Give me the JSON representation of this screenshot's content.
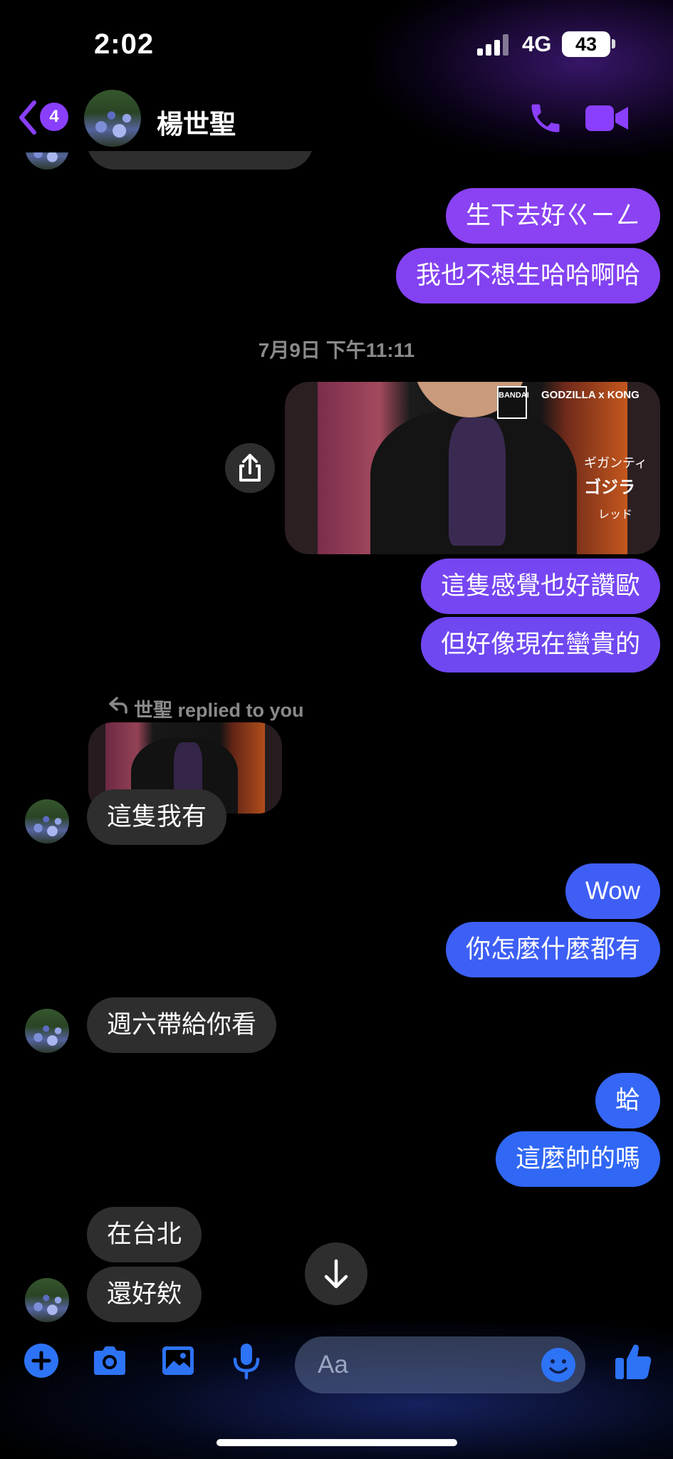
{
  "status_bar": {
    "time": "2:02",
    "network": "4G",
    "battery": "43"
  },
  "header": {
    "back_badge_count": "4",
    "contact_name": "楊世聖",
    "colors": {
      "accent": "#8a3ffc"
    }
  },
  "timestamp": "7月9日 下午11:11",
  "reply_label": "世聖 replied to you",
  "messages": {
    "out_1": "生下去好ㄍㄧㄥ",
    "out_2": "我也不想生哈哈啊哈",
    "out_3": "這隻感覺也好讚歐",
    "out_4": "但好像現在蠻貴的",
    "in_1": "這隻我有",
    "out_5": "Wow",
    "out_6": "你怎麼什麼都有",
    "in_2": "週六帶給你看",
    "out_7": "蛤",
    "out_8": "這麼帥的嗎",
    "in_3": "在台北",
    "in_4": "還好欸"
  },
  "photo_text": {
    "brand": "BANDAI",
    "title": "GODZILLA x KONG",
    "jp_1": "ギガンティ",
    "jp_2": "ゴジラ",
    "jp_3": "レッド"
  },
  "composer": {
    "placeholder": "Aa"
  },
  "icons": {
    "back": "chevron-left-icon",
    "call": "phone-icon",
    "video": "video-camera-icon",
    "share": "share-icon",
    "scroll": "arrow-down-icon",
    "add": "plus-circle-icon",
    "camera": "camera-icon",
    "gallery": "image-icon",
    "mic": "microphone-icon",
    "emoji": "smiley-icon",
    "like": "thumbs-up-icon"
  }
}
